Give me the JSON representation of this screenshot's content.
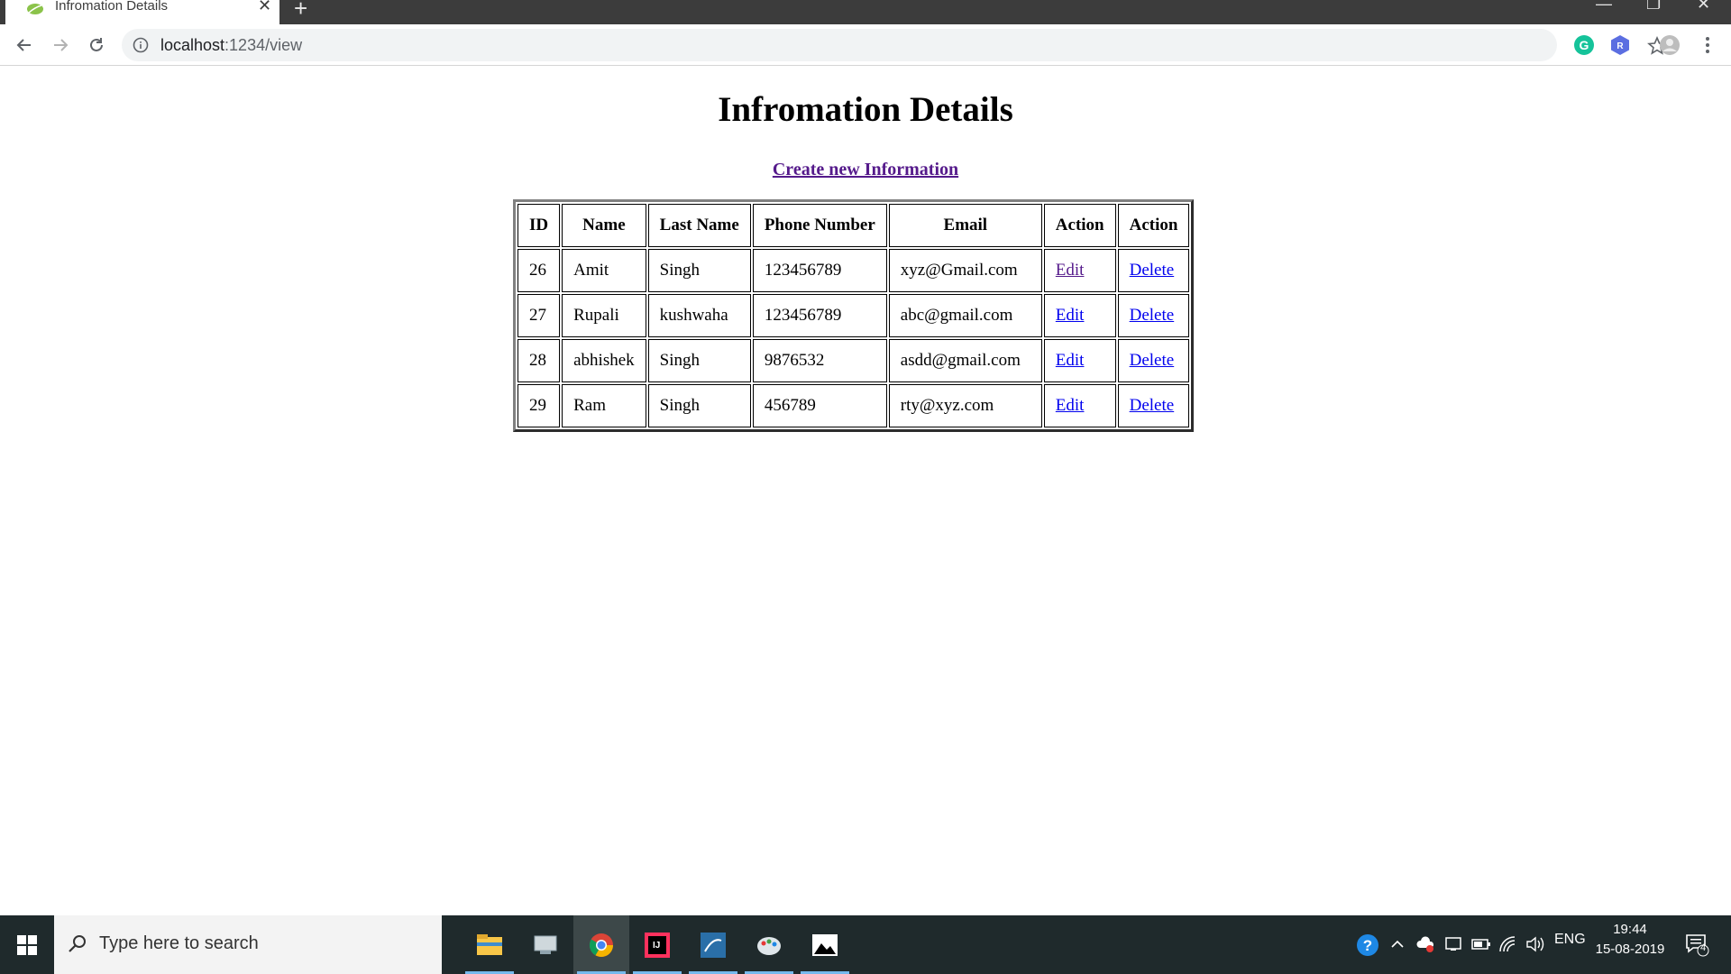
{
  "browser": {
    "tab_title": "Infromation Details",
    "tab_close": "✕",
    "new_tab": "+",
    "url_host": "localhost",
    "url_path": ":1234/view"
  },
  "page": {
    "title": "Infromation Details",
    "create_link": "Create new Information "
  },
  "table": {
    "headers": [
      "ID",
      "Name",
      "Last Name",
      "Phone Number",
      "Email",
      "Action",
      "Action"
    ],
    "rows": [
      {
        "id": "26",
        "name": "Amit",
        "last_name": "Singh",
        "phone": "123456789",
        "email": "xyz@Gmail.com",
        "edit": "Edit",
        "delete": "Delete"
      },
      {
        "id": "27",
        "name": "Rupali",
        "last_name": "kushwaha",
        "phone": "123456789",
        "email": "abc@gmail.com",
        "edit": "Edit",
        "delete": "Delete"
      },
      {
        "id": "28",
        "name": "abhishek",
        "last_name": "Singh",
        "phone": "9876532",
        "email": "asdd@gmail.com",
        "edit": "Edit",
        "delete": "Delete"
      },
      {
        "id": "29",
        "name": "Ram",
        "last_name": "Singh",
        "phone": "456789",
        "email": "rty@xyz.com",
        "edit": "Edit",
        "delete": "Delete"
      }
    ]
  },
  "taskbar": {
    "search_placeholder": "Type here to search",
    "language": "ENG",
    "time": "19:44",
    "date": "15-08-2019",
    "notification_count": "4"
  },
  "colors": {
    "link": "#0000ee",
    "visited_link": "#551a8b",
    "tabstrip": "#3c3c3c",
    "taskbar": "#1f2a2c"
  }
}
